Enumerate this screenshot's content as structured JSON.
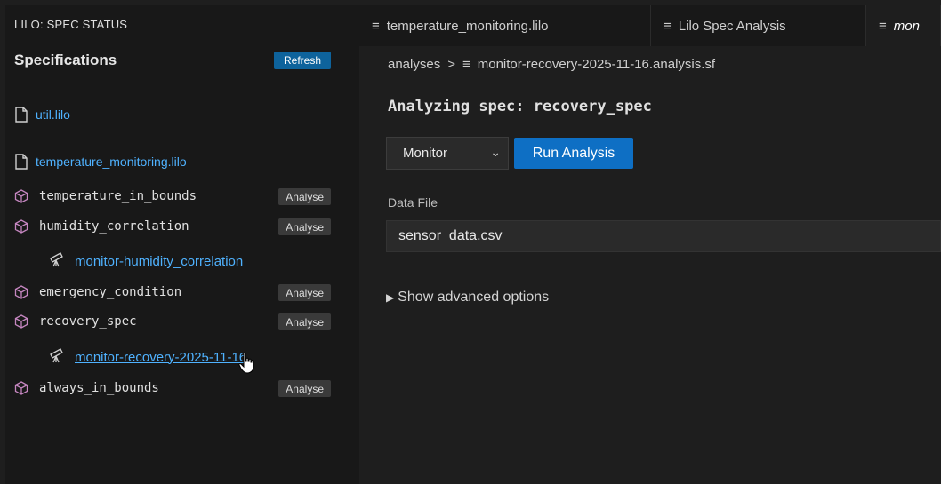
{
  "sidebar": {
    "header": "LILO: SPEC STATUS",
    "section_title": "Specifications",
    "refresh_label": "Refresh",
    "files": [
      {
        "name": "util.lilo"
      },
      {
        "name": "temperature_monitoring.lilo"
      }
    ],
    "specs": [
      {
        "name": "temperature_in_bounds",
        "action": "Analyse"
      },
      {
        "name": "humidity_correlation",
        "action": "Analyse"
      },
      {
        "name": "emergency_condition",
        "action": "Analyse"
      },
      {
        "name": "recovery_spec",
        "action": "Analyse"
      },
      {
        "name": "always_in_bounds",
        "action": "Analyse"
      }
    ],
    "monitors": [
      {
        "name": "monitor-humidity_correlation"
      },
      {
        "name": "monitor-recovery-2025-11-16"
      }
    ]
  },
  "tabs": [
    {
      "label": "temperature_monitoring.lilo",
      "icon": "lines-icon"
    },
    {
      "label": "Lilo Spec Analysis",
      "icon": "lines-icon"
    },
    {
      "label": "mon",
      "icon": "lines-icon"
    }
  ],
  "breadcrumb": {
    "parent": "analyses",
    "separator": ">",
    "current": "monitor-recovery-2025-11-16.analysis.sf"
  },
  "main": {
    "title": "Analyzing spec: recovery_spec",
    "mode_selected": "Monitor",
    "run_label": "Run Analysis",
    "data_file_label": "Data File",
    "data_file_value": "sensor_data.csv",
    "advanced_label": "Show advanced options"
  },
  "colors": {
    "accent": "#0e6fc4",
    "link": "#4fb2ff",
    "sidebar_bg": "#181818",
    "editor_bg": "#1e1e1e"
  }
}
